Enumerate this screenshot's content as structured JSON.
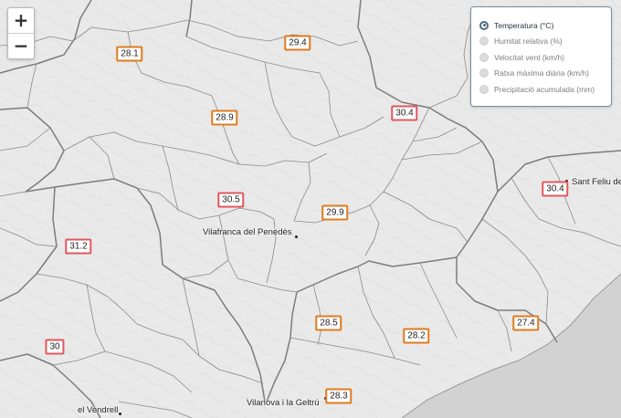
{
  "zoom": {
    "in_label": "+",
    "out_label": "−"
  },
  "legend": {
    "options": [
      {
        "label": "Temperatura (°C)",
        "selected": true
      },
      {
        "label": "Humitat relativa (%)",
        "selected": false
      },
      {
        "label": "Velocitat vent (km/h)",
        "selected": false
      },
      {
        "label": "Ratxa màxima diària (km/h)",
        "selected": false
      },
      {
        "label": "Precipitació acumulada (mm)",
        "selected": false
      }
    ],
    "accent_color": "#4e6c85"
  },
  "marker_colors": {
    "orange": "#e07b1f",
    "red": "#e2585c"
  },
  "stations": [
    {
      "value": "28.1",
      "color": "orange"
    },
    {
      "value": "29.4",
      "color": "orange"
    },
    {
      "value": "30.4",
      "color": "red"
    },
    {
      "value": "28.9",
      "color": "orange"
    },
    {
      "value": "30.5",
      "color": "red"
    },
    {
      "value": "29.9",
      "color": "orange"
    },
    {
      "value": "30.4",
      "color": "red"
    },
    {
      "value": "31.2",
      "color": "red"
    },
    {
      "value": "28.5",
      "color": "orange"
    },
    {
      "value": "28.2",
      "color": "orange"
    },
    {
      "value": "27.4",
      "color": "orange"
    },
    {
      "value": "30",
      "color": "red"
    },
    {
      "value": "28.3",
      "color": "orange"
    }
  ],
  "towns": [
    {
      "name": "Vilafranca del Penedès"
    },
    {
      "name": "Sant Feliu de"
    },
    {
      "name": "Vilanova i la Geltrú"
    },
    {
      "name": "el Vendrell"
    }
  ],
  "map_colors": {
    "land": "#e9e9e9",
    "sea": "#d2d2d2",
    "border": "#7c7c7c"
  }
}
